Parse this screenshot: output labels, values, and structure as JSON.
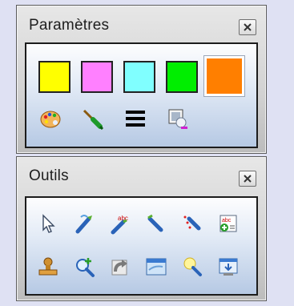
{
  "params": {
    "title": "Paramètres",
    "swatches": [
      "#ffff00",
      "#ff80ff",
      "#80ffff",
      "#00ee00",
      "#ff7f00"
    ],
    "selected_color": "#ff7f00",
    "tools": [
      "palette-icon",
      "pen-width-icon",
      "line-style-icon",
      "brush-settings-icon"
    ]
  },
  "tools": {
    "title": "Outils",
    "row1": [
      "select-arrow-icon",
      "pen-icon",
      "spellcheck-icon",
      "highlighter-icon",
      "eraser-icon",
      "add-text-icon"
    ],
    "row2": [
      "stamp-icon",
      "zoom-in-icon",
      "redo-icon",
      "window-icon",
      "magic-wand-icon",
      "screen-capture-icon"
    ]
  }
}
